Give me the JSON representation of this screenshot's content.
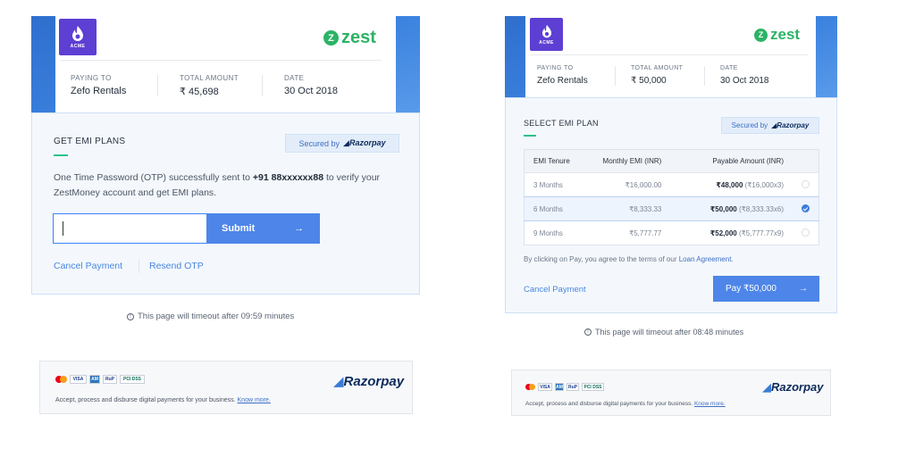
{
  "left": {
    "merchant_logo_text": "ACME",
    "brand": "zest",
    "header": {
      "paying_to_label": "PAYING TO",
      "paying_to_value": "Zefo Rentals",
      "total_amount_label": "TOTAL AMOUNT",
      "total_amount_value": "₹ 45,698",
      "date_label": "DATE",
      "date_value": "30 Oct 2018"
    },
    "section_title": "GET EMI PLANS",
    "secured_by": "Secured by",
    "secured_brand": "Razorpay",
    "otp_message_pre": "One Time Password (OTP) successfully sent to ",
    "otp_phone": "+91 88xxxxxx88",
    "otp_message_post": " to verify your ZestMoney account and get EMI plans.",
    "otp_input_value": "",
    "submit_label": "Submit",
    "cancel_label": "Cancel Payment",
    "resend_label": "Resend OTP",
    "timeout_text": "This page will timeout after 09:59 minutes",
    "footer": {
      "brand": "Razorpay",
      "text": "Accept, process and disburse digital payments for your business.",
      "link": "Know more."
    }
  },
  "right": {
    "merchant_logo_text": "ACME",
    "brand": "zest",
    "header": {
      "paying_to_label": "PAYING TO",
      "paying_to_value": "Zefo Rentals",
      "total_amount_label": "TOTAL AMOUNT",
      "total_amount_value": "₹ 50,000",
      "date_label": "DATE",
      "date_value": "30 Oct 2018"
    },
    "section_title": "SELECT EMI PLAN",
    "secured_by": "Secured by",
    "secured_brand": "Razorpay",
    "table": {
      "headers": [
        "EMI Tenure",
        "Monthly EMI (INR)",
        "Payable Amount (INR)"
      ],
      "rows": [
        {
          "tenure": "3 Months",
          "monthly": "₹16,000.00",
          "payable": "₹48,000",
          "payable_detail": "(₹16,000x3)",
          "selected": false
        },
        {
          "tenure": "6 Months",
          "monthly": "₹8,333.33",
          "payable": "₹50,000",
          "payable_detail": "(₹8,333.33x6)",
          "selected": true
        },
        {
          "tenure": "9 Months",
          "monthly": "₹5,777.77",
          "payable": "₹52,000",
          "payable_detail": "(₹5,777.77x9)",
          "selected": false
        }
      ]
    },
    "agree_pre": "By clicking on Pay, you agree to the terms of our ",
    "agree_link": "Loan Agreement",
    "agree_post": ".",
    "cancel_label": "Cancel Payment",
    "pay_label": "Pay ₹50,000",
    "timeout_text": "This page will timeout after 08:48 minutes",
    "footer": {
      "brand": "Razorpay",
      "text": "Accept, process and disburse digital payments for your business.",
      "link": "Know more."
    }
  },
  "card_logos": [
    "mastercard-icon",
    "visa-icon",
    "amex-icon",
    "rupay-icon",
    "pci-dss-icon"
  ],
  "colors": {
    "accent_blue": "#4d86e8",
    "zest_green": "#2cb365",
    "acme_purple": "#5d3fd3",
    "underline_green": "#2cc28b"
  }
}
